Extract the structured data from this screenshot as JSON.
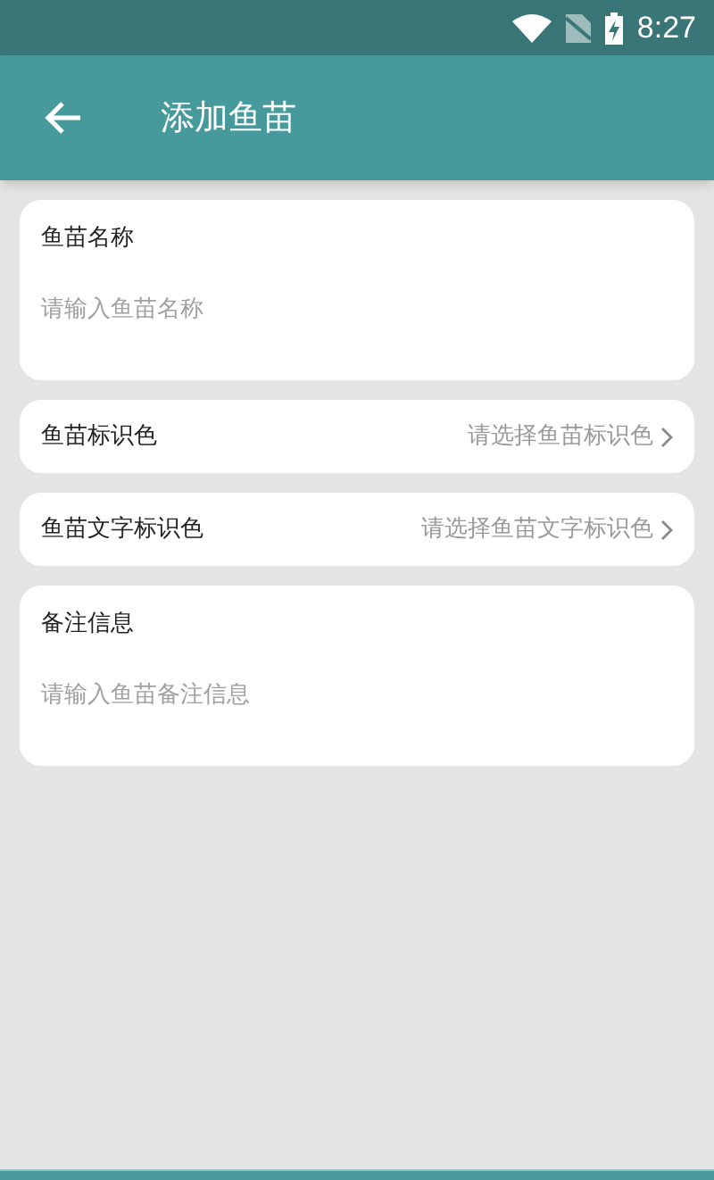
{
  "status_bar": {
    "time": "8:27"
  },
  "app_bar": {
    "title": "添加鱼苗"
  },
  "form": [
    {
      "kind": "input",
      "label": "鱼苗名称",
      "placeholder": "请输入鱼苗名称"
    },
    {
      "kind": "select",
      "label": "鱼苗标识色",
      "placeholder": "请选择鱼苗标识色"
    },
    {
      "kind": "select",
      "label": "鱼苗文字标识色",
      "placeholder": "请选择鱼苗文字标识色"
    },
    {
      "kind": "input",
      "label": "备注信息",
      "placeholder": "请输入鱼苗备注信息"
    }
  ]
}
